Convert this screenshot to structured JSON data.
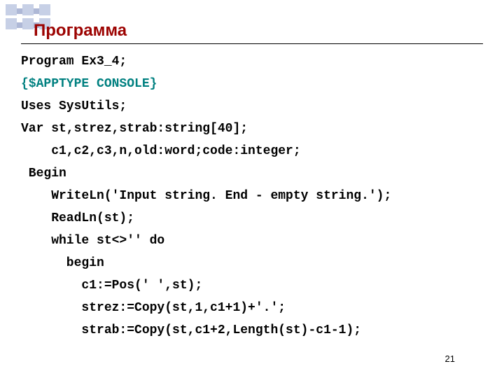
{
  "title": "Программа",
  "code": {
    "l1": "Program Ex3_4;",
    "l2": "{$APPTYPE CONSOLE}",
    "l3": "Uses SysUtils;",
    "l4": "Var st,strez,strab:string[40];",
    "l5": "    c1,c2,c3,n,old:word;code:integer;",
    "l6": " Begin",
    "l7": "    WriteLn('Input string. End - empty string.');",
    "l8": "    ReadLn(st);",
    "l9": "    while st<>'' do",
    "l10": "      begin",
    "l11": "        c1:=Pos(' ',st);",
    "l12": "        strez:=Copy(st,1,c1+1)+'.';",
    "l13": "        strab:=Copy(st,c1+2,Length(st)-c1-1);"
  },
  "pageNumber": "21"
}
